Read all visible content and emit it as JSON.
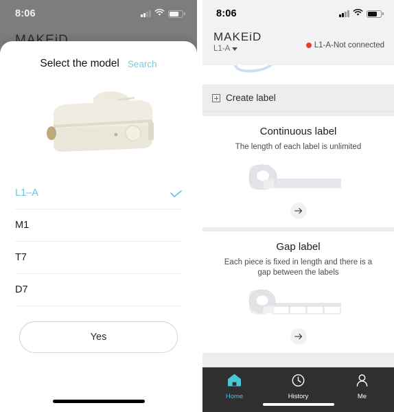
{
  "left": {
    "status": {
      "time": "8:06",
      "signal_icon": "cellular-bars-icon",
      "wifi_icon": "wifi-icon",
      "battery_icon": "battery-icon"
    },
    "watermark_brand": "MAKEiD",
    "sheet": {
      "title": "Select the model",
      "search_label": "Search",
      "device_image_alt": "label-printer-device",
      "models": [
        {
          "name": "L1–A",
          "selected": true
        },
        {
          "name": "M1",
          "selected": false
        },
        {
          "name": "T7",
          "selected": false
        },
        {
          "name": "D7",
          "selected": false
        }
      ],
      "confirm_label": "Yes"
    }
  },
  "right": {
    "status": {
      "time": "8:06",
      "signal_icon": "cellular-bars-icon",
      "wifi_icon": "wifi-icon",
      "battery_icon": "battery-icon"
    },
    "appbar": {
      "brand": "MAKEiD",
      "model": "L1-A",
      "connection_status": "L1-A-Not connected",
      "status_dot_color": "#e5412a"
    },
    "create_label_row": "Create label",
    "cards": [
      {
        "title": "Continuous label",
        "subtitle": "The length of each label is unlimited",
        "art": "continuous-tape-roll",
        "go_icon": "arrow-right-icon"
      },
      {
        "title": "Gap label",
        "subtitle": "Each piece is fixed in length and there is a gap between the labels",
        "art": "gap-tape-roll",
        "go_icon": "arrow-right-icon"
      }
    ],
    "tabbar": [
      {
        "label": "Home",
        "icon": "home-icon",
        "active": true
      },
      {
        "label": "History",
        "icon": "clock-icon",
        "active": false
      },
      {
        "label": "Me",
        "icon": "person-icon",
        "active": false
      }
    ],
    "accent_color": "#4cc5d4"
  }
}
